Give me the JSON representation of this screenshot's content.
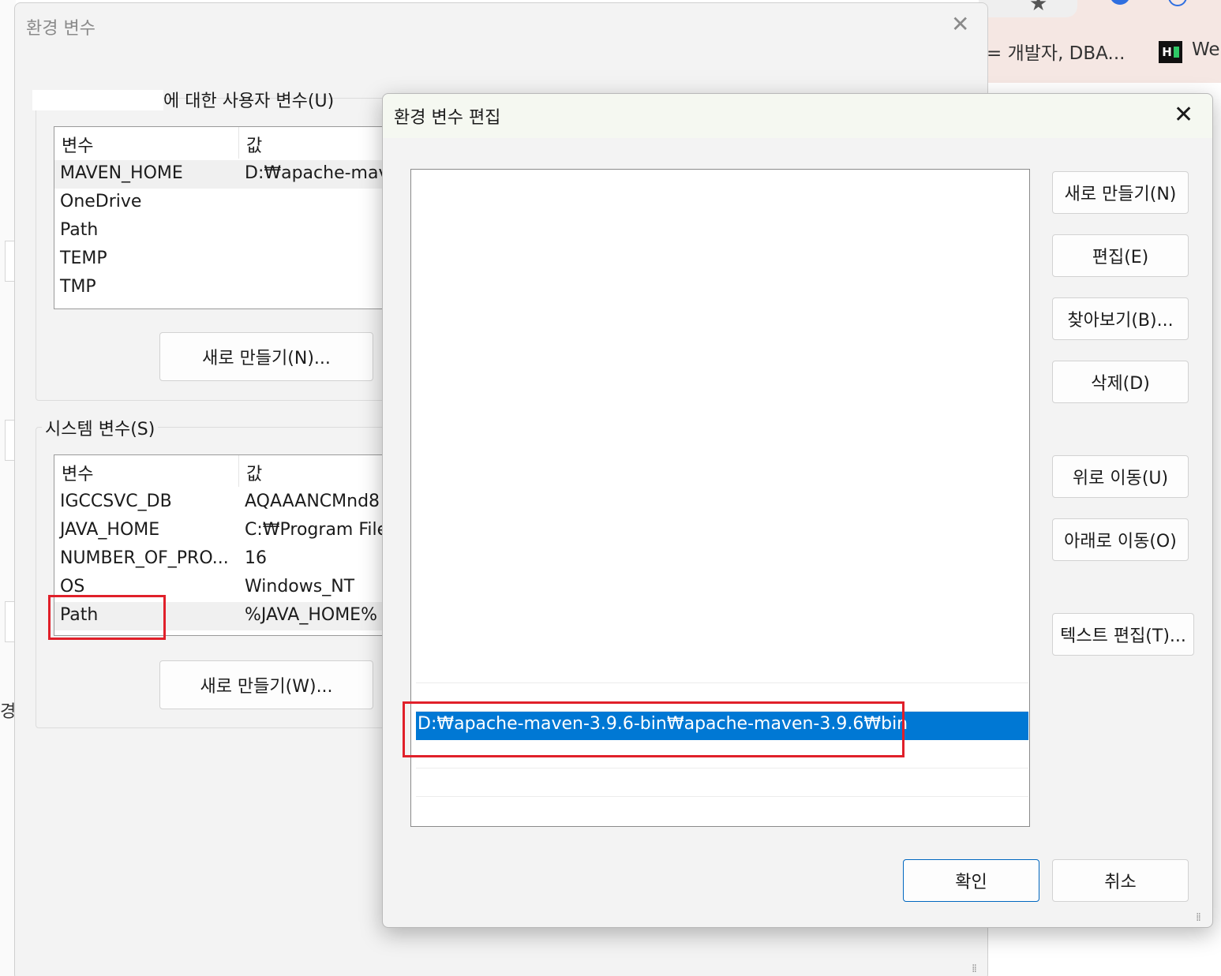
{
  "background": {
    "bookmark_text": "= 개발자, DBA...",
    "bookmark_we": "We",
    "logo_text": "H",
    "edge_char": "경"
  },
  "env_window": {
    "title": "환경 변수",
    "close_icon": "close-icon",
    "user_group_label": "에 대한 사용자 변수(U)",
    "user_table": {
      "col_var": "변수",
      "col_value": "값",
      "rows": [
        {
          "name": "MAVEN_HOME",
          "value": "D:₩apache-mave"
        },
        {
          "name": "OneDrive",
          "value": ""
        },
        {
          "name": "Path",
          "value": ""
        },
        {
          "name": "TEMP",
          "value": ""
        },
        {
          "name": "TMP",
          "value": ""
        }
      ]
    },
    "user_new_button": "새로 만들기(N)...",
    "system_group_label": "시스템 변수(S)",
    "system_table": {
      "col_var": "변수",
      "col_value": "값",
      "rows": [
        {
          "name": "IGCCSVC_DB",
          "value": "AQAAANCMnd8"
        },
        {
          "name": "JAVA_HOME",
          "value": "C:₩Program File"
        },
        {
          "name": "NUMBER_OF_PRO...",
          "value": "16"
        },
        {
          "name": "OS",
          "value": "Windows_NT"
        },
        {
          "name": "Path",
          "value": "%JAVA_HOME%"
        }
      ]
    },
    "system_new_button": "새로 만들기(W)..."
  },
  "edit_dialog": {
    "title": "환경 변수 편집",
    "paths": [
      "D:₩apache-maven-3.9.6-bin₩apache-maven-3.9.6₩bin"
    ],
    "buttons": {
      "new": "새로 만들기(N)",
      "edit": "편집(E)",
      "browse": "찾아보기(B)...",
      "delete": "삭제(D)",
      "move_up": "위로 이동(U)",
      "move_down": "아래로 이동(O)",
      "edit_text": "텍스트 편집(T)...",
      "ok": "확인",
      "cancel": "취소"
    }
  },
  "colors": {
    "selection": "#0078d4",
    "highlight_box": "#e0202a",
    "ok_border": "#0067c0"
  }
}
